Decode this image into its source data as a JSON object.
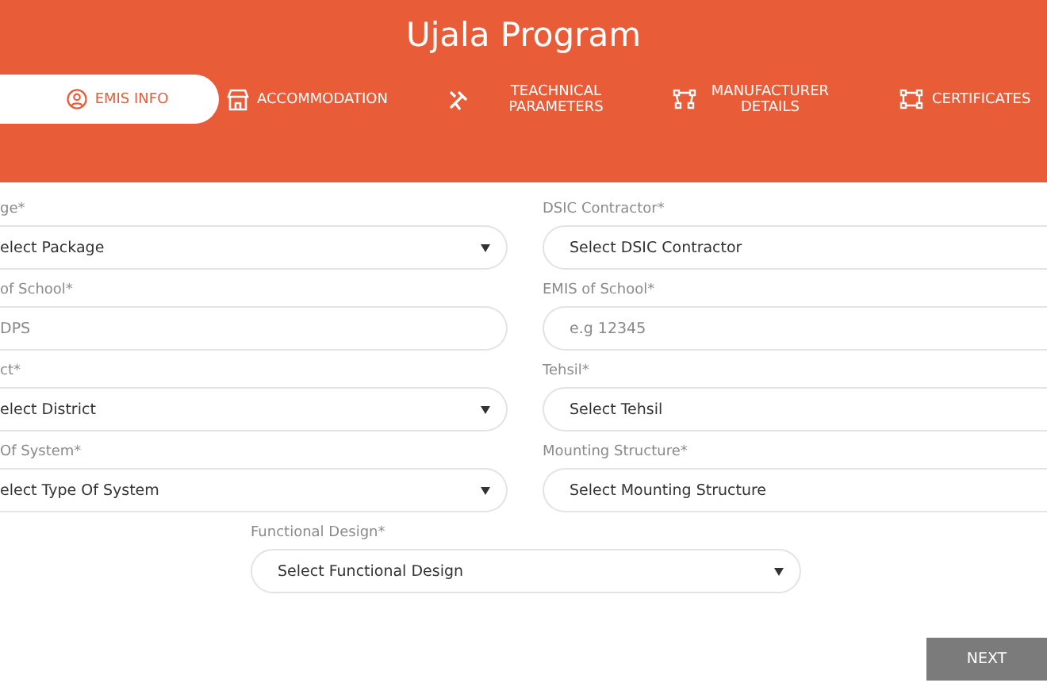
{
  "header": {
    "title": "Ujala Program"
  },
  "tabs": [
    {
      "label": "EMIS INFO",
      "selected": true
    },
    {
      "label": "ACCOMMODATION",
      "selected": false
    },
    {
      "label": "TEACHNICAL PARAMETERS",
      "selected": false
    },
    {
      "label": "MANUFACTURER DETAILS",
      "selected": false
    },
    {
      "label": "CERTIFICATES",
      "selected": false
    }
  ],
  "form": {
    "rows": [
      [
        {
          "label": "ge*",
          "kind": "select",
          "value": "elect Package",
          "caret": true
        },
        {
          "label": "DSIC Contractor*",
          "kind": "select",
          "value": "Select DSIC Contractor",
          "caret": false
        }
      ],
      [
        {
          "label": "of School*",
          "kind": "text",
          "placeholder": "DPS"
        },
        {
          "label": "EMIS of School*",
          "kind": "text",
          "placeholder": "e.g 12345"
        }
      ],
      [
        {
          "label": "ct*",
          "kind": "select",
          "value": "elect District",
          "caret": true
        },
        {
          "label": "Tehsil*",
          "kind": "select",
          "value": "Select Tehsil",
          "caret": false
        }
      ],
      [
        {
          "label": "Of System*",
          "kind": "select",
          "value": "elect Type Of System",
          "caret": true
        },
        {
          "label": "Mounting Structure*",
          "kind": "select",
          "value": "Select Mounting Structure",
          "caret": false
        }
      ]
    ],
    "bottom_field": {
      "label": "Functional Design*",
      "kind": "select",
      "value": "Select Functional Design",
      "caret": true
    }
  },
  "next_button": "NEXT"
}
